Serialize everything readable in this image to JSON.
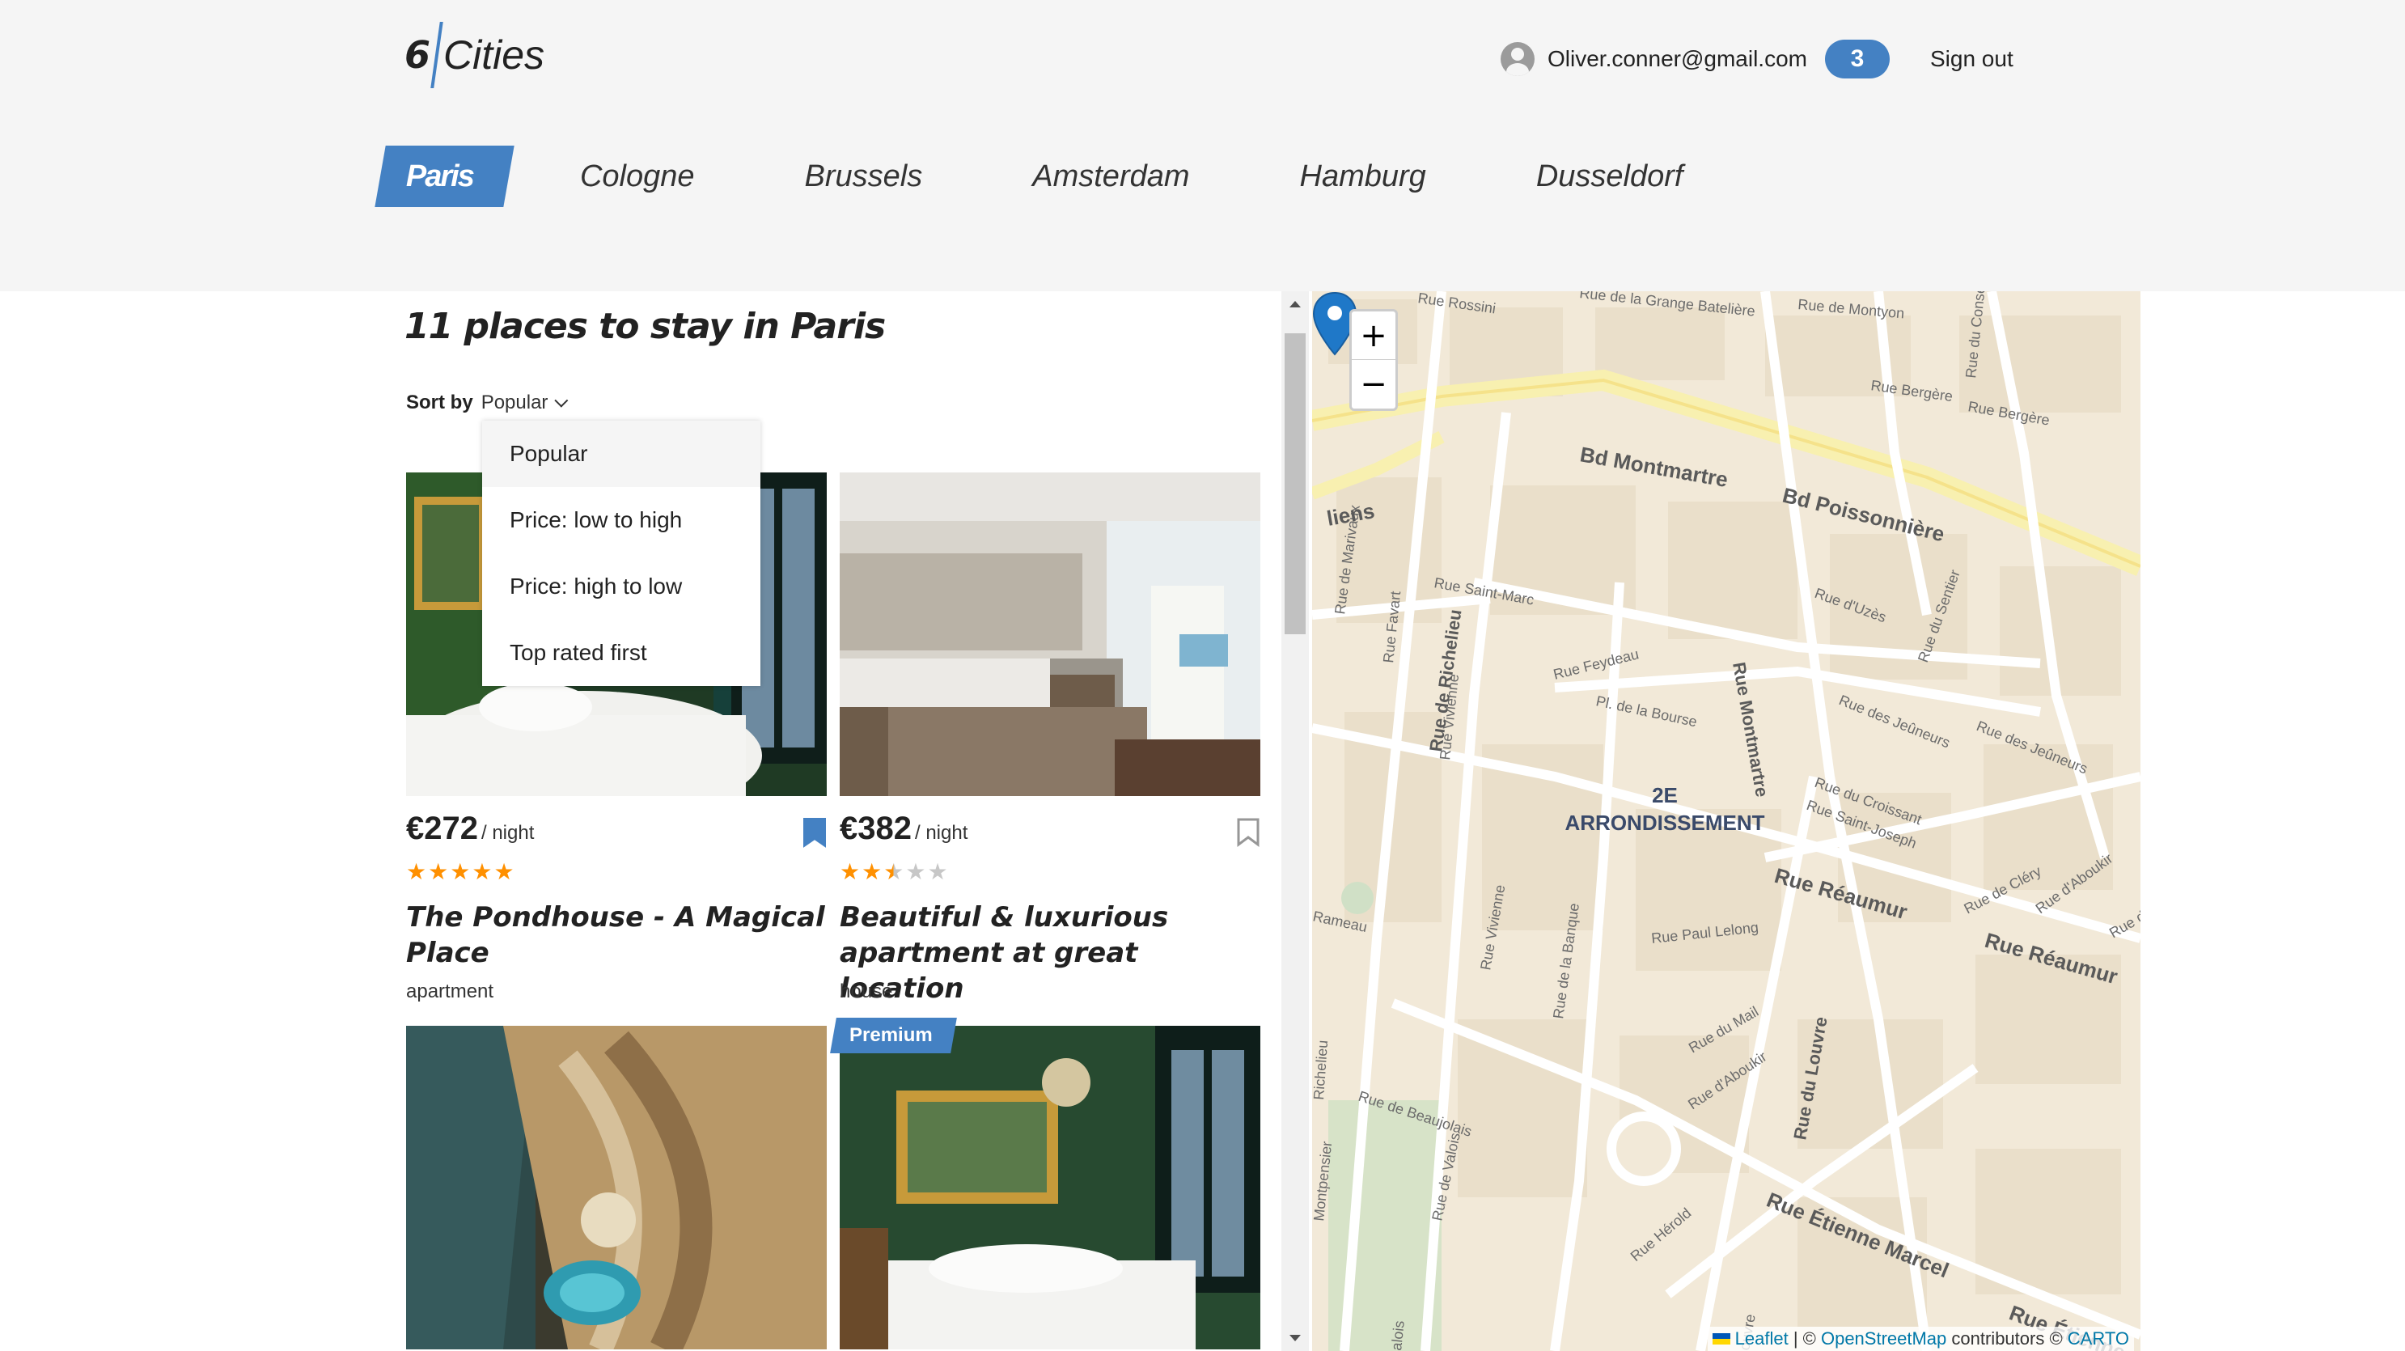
{
  "header": {
    "logo_number": "6",
    "logo_text": "Cities",
    "user_email": "Oliver.conner@gmail.com",
    "favorites_count": "3",
    "sign_out": "Sign out"
  },
  "tabs": [
    {
      "label": "Paris",
      "active": true
    },
    {
      "label": "Cologne"
    },
    {
      "label": "Brussels"
    },
    {
      "label": "Amsterdam"
    },
    {
      "label": "Hamburg"
    },
    {
      "label": "Dusseldorf"
    }
  ],
  "main": {
    "title": "11 places to stay in Paris",
    "sort_label": "Sort by",
    "sort_value": "Popular"
  },
  "sort_options": [
    "Popular",
    "Price: low to high",
    "Price: high to low",
    "Top rated first"
  ],
  "cards": [
    {
      "price": "€272",
      "per_night": "/ night",
      "rating": 5,
      "title": "The Pondhouse - A Magical Place",
      "type": "apartment",
      "bookmarked": true
    },
    {
      "price": "€382",
      "per_night": "/ night",
      "rating": 2.5,
      "title": "Beautiful & luxurious apartment at great location",
      "type": "house",
      "bookmarked": false
    },
    {
      "premium": false
    },
    {
      "premium": true,
      "premium_label": "Premium"
    }
  ],
  "map": {
    "zoom_in": "+",
    "zoom_out": "−",
    "district_line1": "2E",
    "district_line2": "ARRONDISSEMENT",
    "streets": [
      "Rue Rossini",
      "Rue de la Grange Batelière",
      "Rue de Montyon",
      "Rue Bergère",
      "Bd Montmartre",
      "Bd Poissonnière",
      "Rue d'Uzès",
      "Rue Saint-Marc",
      "Rue Feydeau",
      "Pl. de la Bourse",
      "Rue des Jeûneurs",
      "Rue du Croissant",
      "Rue Saint-Joseph",
      "Rue Réaumur",
      "Rue de Cléry",
      "Rue d'Aboukir",
      "Rue Paul Lelong",
      "Rue du Mail",
      "Rue de Beaujolais",
      "Rue Hérold",
      "Rue Étienne Marcel",
      "Rue de Richelieu",
      "Rue Vivienne",
      "Rue de la Banque",
      "Rue Montmartre",
      "Rue du Louvre",
      "Rue de Valois",
      "Rue du Sentier",
      "Rue Favart",
      "Rue de Marivaux",
      "Montpensier",
      "Rameau"
    ],
    "attribution": {
      "leaflet": "Leaflet",
      "sep1": " | © ",
      "osm": "OpenStreetMap",
      "mid": " contributors © ",
      "carto": "CARTO"
    }
  },
  "colors": {
    "accent": "#4481c3",
    "star": "#ff9000",
    "background": "#f5f5f5"
  },
  "icons": [
    "user-avatar-icon",
    "bookmark-icon",
    "star-icon",
    "map-marker-icon",
    "chevron-down-icon"
  ]
}
